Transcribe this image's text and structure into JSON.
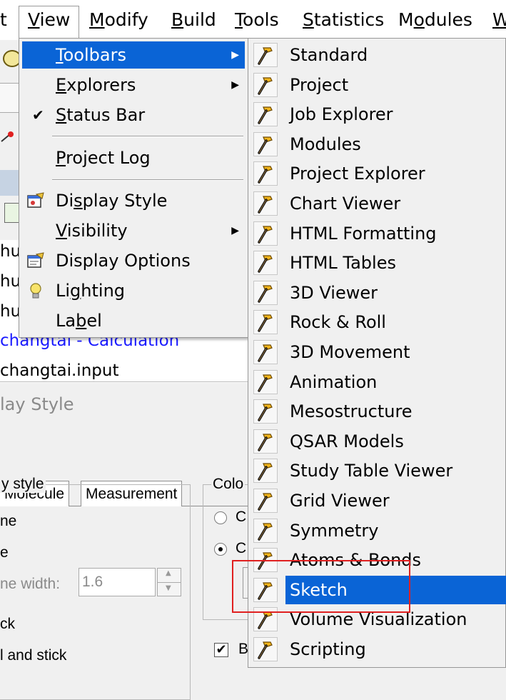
{
  "menubar": {
    "items": [
      {
        "label": "t"
      },
      {
        "label": "View"
      },
      {
        "label": "Modify"
      },
      {
        "label": "Build"
      },
      {
        "label": "Tools"
      },
      {
        "label": "Statistics"
      },
      {
        "label": "Modules"
      },
      {
        "label": "W"
      }
    ]
  },
  "view_menu": {
    "items": [
      {
        "label": "Toolbars",
        "submenu": true,
        "highlighted": true
      },
      {
        "label": "Explorers",
        "submenu": true
      },
      {
        "label": "Status Bar",
        "checked": true
      },
      {
        "label": "Project Log"
      },
      {
        "label": "Display Style",
        "icon": "display-style-icon"
      },
      {
        "label": "Visibility",
        "submenu": true
      },
      {
        "label": "Display Options",
        "icon": "display-options-icon"
      },
      {
        "label": "Lighting",
        "icon": "lightbulb-icon"
      },
      {
        "label": "Label"
      }
    ]
  },
  "toolbars_menu": {
    "items": [
      {
        "label": "Standard"
      },
      {
        "label": "Project"
      },
      {
        "label": "Job Explorer"
      },
      {
        "label": "Modules"
      },
      {
        "label": "Project Explorer"
      },
      {
        "label": "Chart Viewer"
      },
      {
        "label": "HTML Formatting"
      },
      {
        "label": "HTML Tables"
      },
      {
        "label": "3D Viewer"
      },
      {
        "label": "Rock & Roll"
      },
      {
        "label": "3D Movement"
      },
      {
        "label": "Animation"
      },
      {
        "label": "Mesostructure"
      },
      {
        "label": "QSAR Models"
      },
      {
        "label": "Study Table Viewer"
      },
      {
        "label": "Grid Viewer"
      },
      {
        "label": "Symmetry"
      },
      {
        "label": "Atoms & Bonds"
      },
      {
        "label": "Sketch",
        "highlighted": true
      },
      {
        "label": "Volume Visualization"
      },
      {
        "label": "Scripting"
      }
    ],
    "item_icon": "hammer-icon"
  },
  "background": {
    "tree_rows": [
      "hu",
      "hu",
      "hu"
    ],
    "calc_row": "changtai - Calculation",
    "input_row": "changtai.input",
    "panel_title": "lay Style",
    "tabs": [
      "Molecule",
      "Measurement"
    ],
    "group_display": "y style",
    "group_color": "Colo",
    "options": [
      "ne",
      "e",
      "ck",
      "l and stick"
    ],
    "line_width_label": "ne width:",
    "line_width_value": "1.6",
    "radio_c1": "C",
    "radio_c2": "C",
    "checkbox_label": "B"
  },
  "colors": {
    "highlight": "#0a64d6",
    "annotation_box": "#e02020",
    "calc_link": "#1a1aff"
  }
}
